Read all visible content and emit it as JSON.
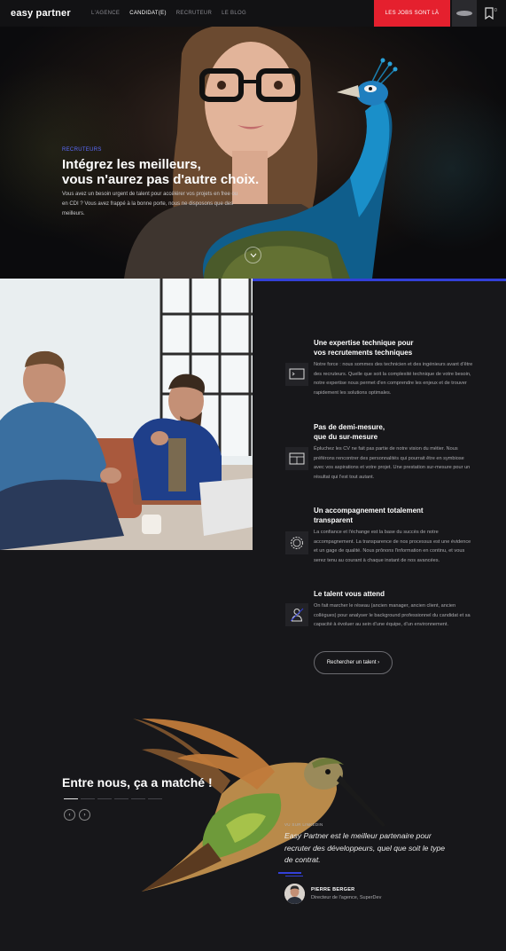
{
  "nav": {
    "logo": "easy partner",
    "links": [
      "L'AGENCE",
      "CANDIDAT(E)",
      "RECRUTEUR",
      "LE BLOG"
    ],
    "jobs_button": "LES JOBS SONT LÀ",
    "bookmark_count": "0"
  },
  "hero": {
    "tag": "RECRUTEURS",
    "title_line1": "Intégrez les meilleurs,",
    "title_line2": "vous n'aurez pas d'autre choix.",
    "text": "Vous avez un besoin urgent de talent pour accélérer vos projets en free ou en CDI ? Vous avez frappé à la bonne porte, nous ne disposons que des meilleurs."
  },
  "features": [
    {
      "title_line1": "Une expertise technique pour",
      "title_line2": "vos recrutements techniques",
      "text": "Notre force : nous sommes des technicien et des ingénieurs avant d'être des recruteurs. Quelle que soit la complexité technique de votre besoin, notre expertise nous permet d'en comprendre les enjeux et de trouver rapidement les solutions optimales."
    },
    {
      "title_line1": "Pas de demi-mesure,",
      "title_line2": "que du sur-mesure",
      "text": "Épluchez les CV ne fait pas partie de notre vision du métier. Nous préférons rencontrer des personnalités qui pourrait être en symbiose avec vos aspirations et votre projet. Une prestation sur-mesure pour un résultat qui l'est tout autant."
    },
    {
      "title_line1": "Un accompagnement totalement",
      "title_line2": "transparent",
      "text": "La confiance et l'échange est la base du succès de notre accompagnement. La transparence de nos processus est une évidence et un gage de qualité. Nous prônons l'information en continu, et vous serez tenu au courant à chaque instant de nos avancées."
    },
    {
      "title_line1": "Le talent vous attend",
      "title_line2": "",
      "text": "On fait marcher le réseau (ancien manager, ancien client, ancien collègues) pour analyser le background professionnel du candidat et sa capacité à évoluer au sein d'une équipe, d'un environnement."
    }
  ],
  "cta": {
    "label": "Rechercher un talent ›"
  },
  "testimonial": {
    "heading": "Entre nous, ça a matché !",
    "prev": "‹",
    "next": "›",
    "source": "VU SUR LINKEDIN",
    "quote": "Easy Partner est le meilleur partenaire pour recruter des développeurs, quel que soit le type de contrat.",
    "author": "PIERRE BERGER",
    "role": "Directeur de l'agence, SuperDev"
  }
}
